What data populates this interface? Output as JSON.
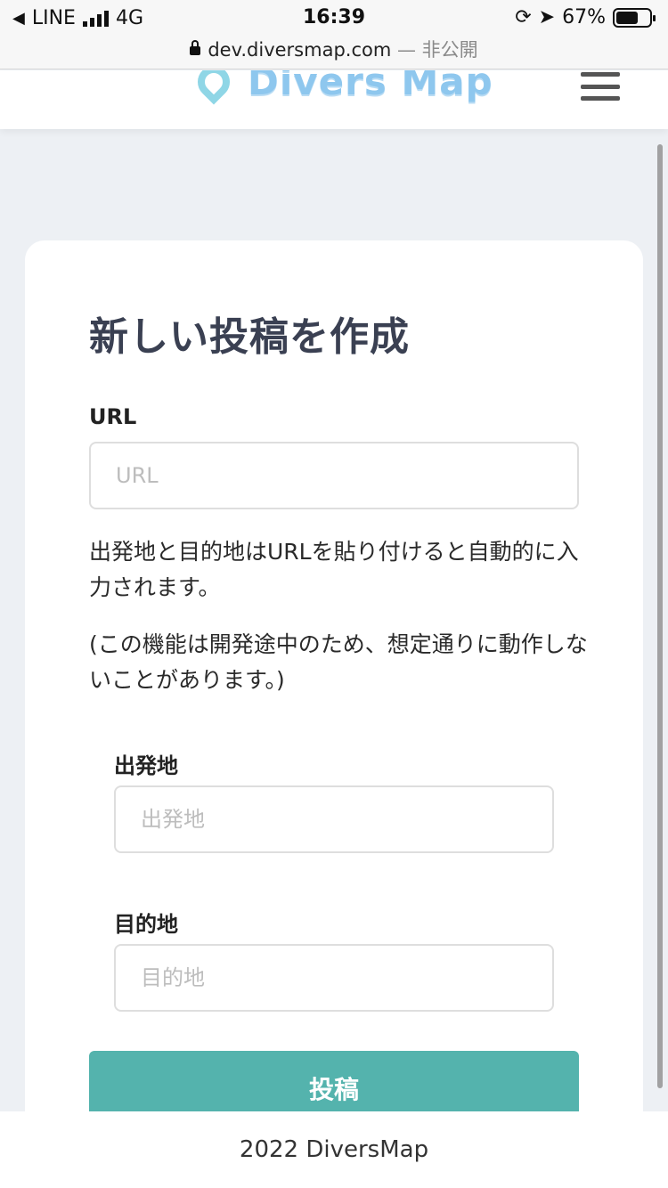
{
  "status_bar": {
    "carrier": "LINE",
    "network": "4G",
    "time": "16:39",
    "battery": "67%",
    "battery_level": 0.67
  },
  "url_bar": {
    "domain": "dev.diversmap.com",
    "suffix": "— 非公開"
  },
  "header": {
    "logo_text": "Divers Map",
    "menu_icon": "hamburger-icon"
  },
  "form": {
    "title": "新しい投稿を作成",
    "url_label": "URL",
    "url_placeholder": "URL",
    "url_value": "",
    "note1": "出発地と目的地はURLを貼り付けると自動的に入力されます。",
    "note2": "(この機能は開発途中のため、想定通りに動作しないことがあります。)",
    "origin_label": "出発地",
    "origin_placeholder": "出発地",
    "origin_value": "",
    "destination_label": "目的地",
    "destination_placeholder": "目的地",
    "destination_value": "",
    "submit_label": "投稿"
  },
  "footer": {
    "text": "2022 DiversMap"
  },
  "colors": {
    "accent": "#54b3ad",
    "background": "#edf0f4",
    "logo": "#8ec7ee"
  }
}
